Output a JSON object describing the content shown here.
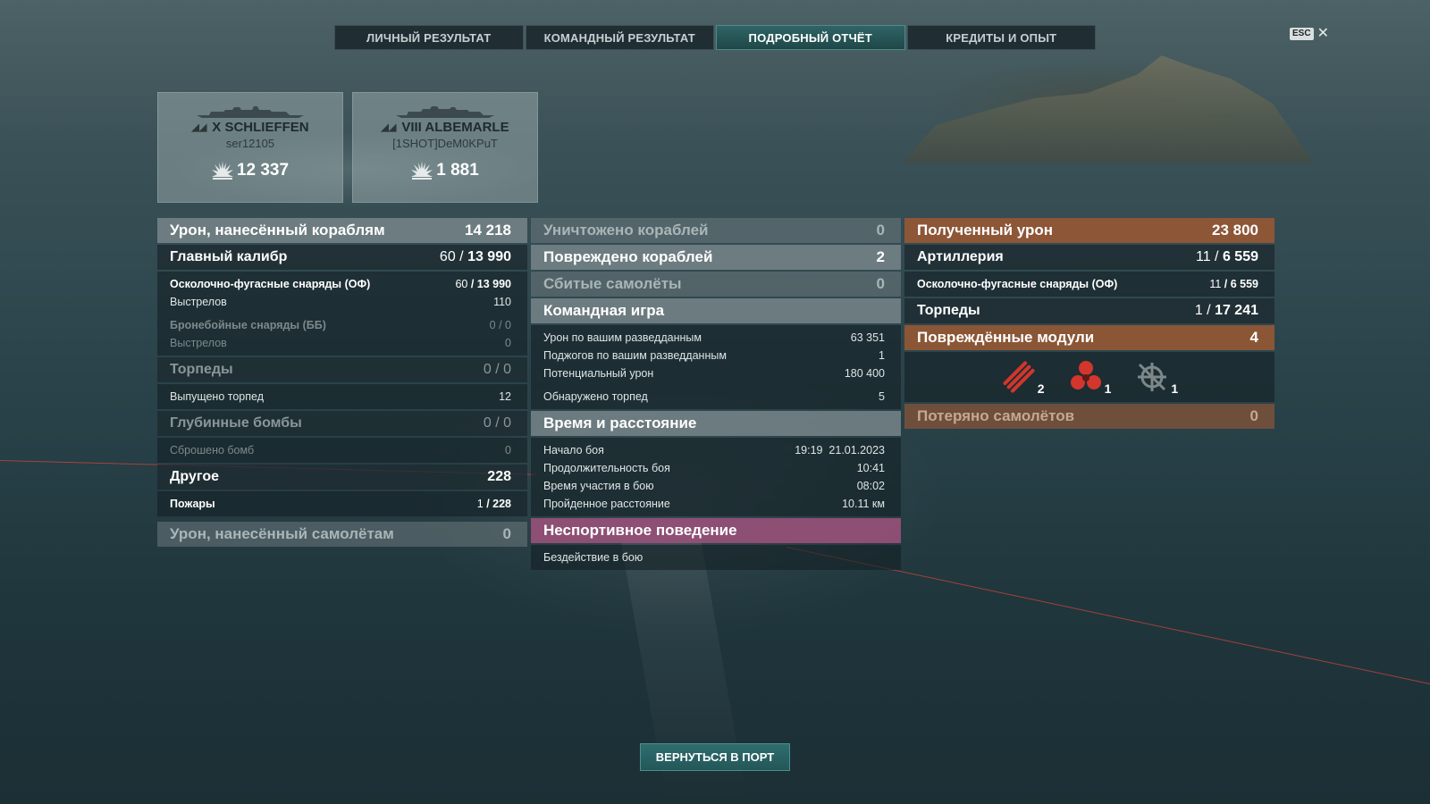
{
  "tabs": [
    {
      "label": "ЛИЧНЫЙ РЕЗУЛЬТАТ",
      "active": false
    },
    {
      "label": "КОМАНДНЫЙ РЕЗУЛЬТАТ",
      "active": false
    },
    {
      "label": "ПОДРОБНЫЙ ОТЧЁТ",
      "active": true
    },
    {
      "label": "КРЕДИТЫ И ОПЫТ",
      "active": false
    }
  ],
  "esc": {
    "key": "ESC",
    "close": "✕"
  },
  "players": [
    {
      "ship": "X SCHLIEFFEN",
      "player": "ser12105",
      "damage": "12 337"
    },
    {
      "ship": "VIII ALBEMARLE",
      "player": "[1SHOT]DeM0KPuT",
      "damage": "1 881"
    }
  ],
  "left": {
    "ship_damage": {
      "label": "Урон, нанесённый кораблям",
      "value": "14 218"
    },
    "main_battery": {
      "label": "Главный калибр",
      "value_a": "60",
      "value_b": "13 990"
    },
    "he": {
      "label": "Осколочно-фугасные снаряды (ОФ)",
      "value_a": "60",
      "value_b": "13 990"
    },
    "he_shots": {
      "label": "Выстрелов",
      "value": "110"
    },
    "ap": {
      "label": "Бронебойные снаряды (ББ)",
      "value": "0 / 0"
    },
    "ap_shots": {
      "label": "Выстрелов",
      "value": "0"
    },
    "torpedoes": {
      "label": "Торпеды",
      "value": "0 / 0"
    },
    "torps_launched": {
      "label": "Выпущено торпед",
      "value": "12"
    },
    "depth_charges": {
      "label": "Глубинные бомбы",
      "value": "0 / 0"
    },
    "bombs_dropped": {
      "label": "Сброшено бомб",
      "value": "0"
    },
    "other": {
      "label": "Другое",
      "value": "228"
    },
    "fires": {
      "label": "Пожары",
      "value_a": "1",
      "value_b": "228"
    },
    "plane_damage": {
      "label": "Урон, нанесённый самолётам",
      "value": "0"
    }
  },
  "middle": {
    "destroyed": {
      "label": "Уничтожено кораблей",
      "value": "0"
    },
    "damaged": {
      "label": "Повреждено кораблей",
      "value": "2"
    },
    "planes_shot": {
      "label": "Сбитые самолёты",
      "value": "0"
    },
    "team_play": {
      "label": "Командная игра"
    },
    "spotting_damage": {
      "label": "Урон по вашим разведданным",
      "value": "63 351"
    },
    "spotting_fires": {
      "label": "Поджогов по вашим разведданным",
      "value": "1"
    },
    "potential": {
      "label": "Потенциальный урон",
      "value": "180 400"
    },
    "torps_spotted": {
      "label": "Обнаружено торпед",
      "value": "5"
    },
    "time_distance": {
      "label": "Время и расстояние"
    },
    "battle_start": {
      "label": "Начало боя",
      "value": "19:19  21.01.2023"
    },
    "duration": {
      "label": "Продолжительность боя",
      "value": "10:41"
    },
    "participation": {
      "label": "Время участия в бою",
      "value": "08:02"
    },
    "distance": {
      "label": "Пройденное расстояние",
      "value": "10.11 км"
    },
    "unsporting": {
      "label": "Неспортивное поведение"
    },
    "idle": {
      "label": "Бездействие в бою"
    }
  },
  "right": {
    "received": {
      "label": "Полученный урон",
      "value": "23 800"
    },
    "artillery": {
      "label": "Артиллерия",
      "value_a": "11",
      "value_b": "6 559"
    },
    "he": {
      "label": "Осколочно-фугасные снаряды (ОФ)",
      "value_a": "11",
      "value_b": "6 559"
    },
    "torpedoes": {
      "label": "Торпеды",
      "value_a": "1",
      "value_b": "17 241"
    },
    "modules": {
      "label": "Повреждённые модули",
      "value": "4"
    },
    "module_icons": [
      {
        "icon": "torpedo-tubes-icon",
        "count": "2",
        "color": "#d2362c"
      },
      {
        "icon": "propeller-icon",
        "count": "1",
        "color": "#d2362c"
      },
      {
        "icon": "steering-gear-icon",
        "count": "1",
        "color": "#7d888a"
      }
    ],
    "planes_lost": {
      "label": "Потеряно самолётов",
      "value": "0"
    }
  },
  "return_button": "ВЕРНУТЬСЯ В ПОРТ"
}
